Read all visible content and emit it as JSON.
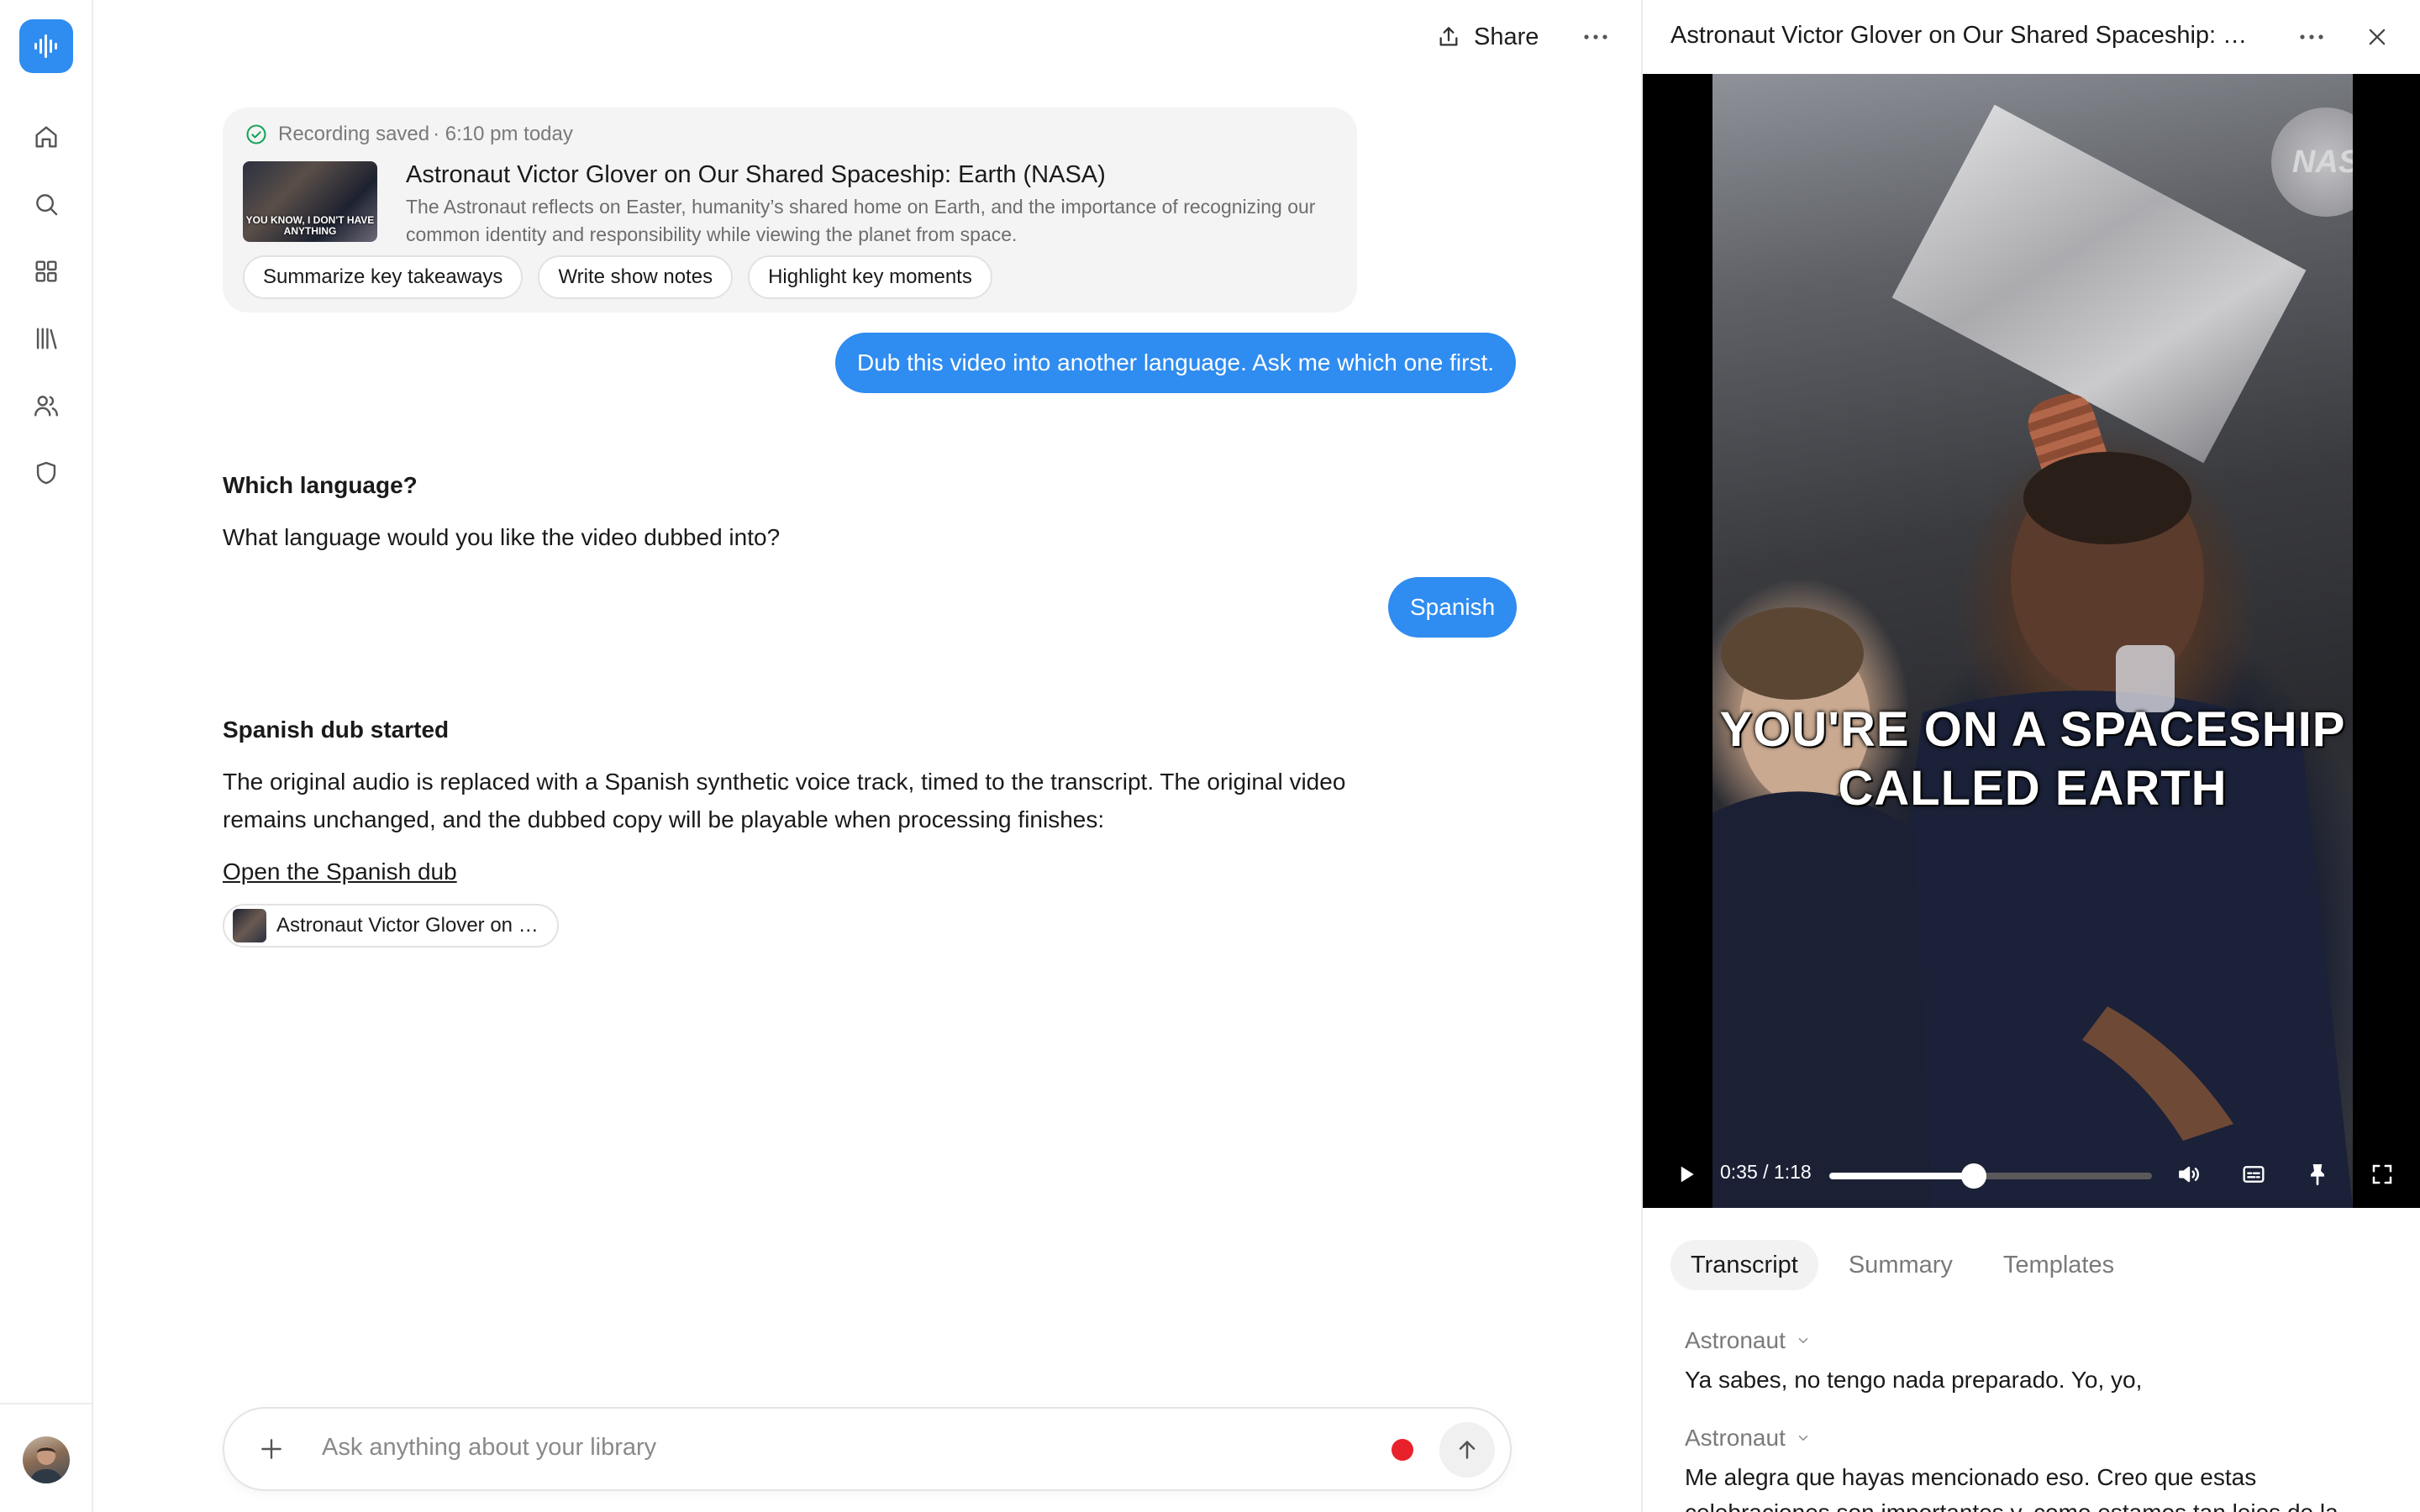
{
  "sidebar": {
    "logo_icon": "waveform-icon",
    "items": [
      {
        "name": "home",
        "icon": "home-icon"
      },
      {
        "name": "search",
        "icon": "search-icon"
      },
      {
        "name": "apps",
        "icon": "grid-icon"
      },
      {
        "name": "library",
        "icon": "library-icon"
      },
      {
        "name": "people",
        "icon": "users-icon"
      },
      {
        "name": "security",
        "icon": "shield-icon"
      }
    ]
  },
  "topbar": {
    "share_label": "Share"
  },
  "recording": {
    "status": "Recording saved",
    "time": "· 6:10 pm today",
    "thumb_caption": "YOU KNOW, I DON'T HAVE ANYTHING",
    "title": "Astronaut Victor Glover on Our Shared Spaceship: Earth (NASA)",
    "description": "The Astronaut reflects on Easter, humanity’s shared home on Earth, and the importance of recognizing our common identity and responsibility while viewing the planet from space.",
    "chips": [
      "Summarize key takeaways",
      "Write show notes",
      "Highlight key moments"
    ]
  },
  "messages": {
    "user_1": "Dub this video into another language. Ask me which one first.",
    "assistant_1_heading": "Which language?",
    "assistant_1_body": "What language would you like the video dubbed into?",
    "user_2": "Spanish",
    "assistant_2_heading": "Spanish dub started",
    "assistant_2_body": "The original audio is replaced with a Spanish synthetic voice track, timed to the transcript. The original video remains unchanged, and the dubbed copy will be playable when processing finishes:",
    "assistant_2_link": "Open the Spanish dub",
    "attachment_label": "Astronaut Victor Glover on …"
  },
  "composer": {
    "placeholder": "Ask anything about your library"
  },
  "panel": {
    "title": "Astronaut Victor Glover on Our Shared Spaceship: Ear…",
    "video": {
      "watermark": "NAS",
      "caption": "YOU'RE ON A SPACESHIP CALLED EARTH",
      "time": "0:35 / 1:18",
      "progress_fraction": 0.449
    },
    "tabs": [
      "Transcript",
      "Summary",
      "Templates"
    ],
    "active_tab": "Transcript",
    "transcript": [
      {
        "speaker": "Astronaut",
        "text": "Ya sabes, no tengo nada preparado. Yo, yo,"
      },
      {
        "speaker": "Astronaut",
        "text": "Me alegra que hayas mencionado eso. Creo que estas celebraciones son importantes y, como estamos tan lejos de la"
      }
    ]
  },
  "colors": {
    "accent": "#2f8cf0",
    "record": "#e8222a",
    "success": "#1aa35a"
  }
}
